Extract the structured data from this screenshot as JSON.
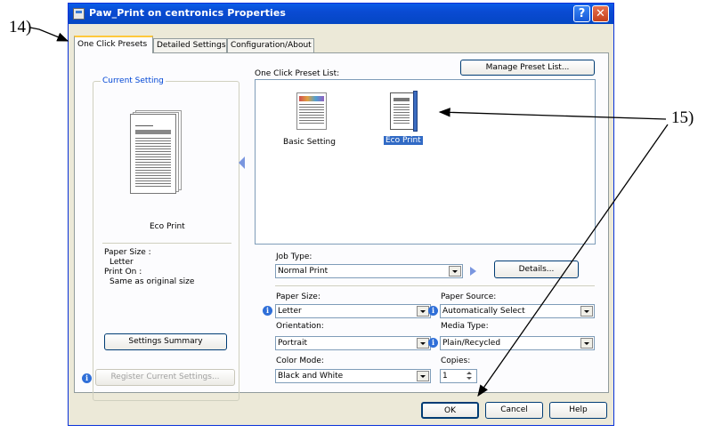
{
  "window": {
    "title": "Paw_Print on centronics Properties"
  },
  "tabs": [
    {
      "label": "One Click Presets"
    },
    {
      "label": "Detailed Settings"
    },
    {
      "label": "Configuration/About"
    }
  ],
  "current_setting": {
    "group_label": "Current Setting",
    "preset_name": "Eco Print",
    "paper_size_label": "Paper Size :",
    "paper_size_value": "Letter",
    "print_on_label": "Print On :",
    "print_on_value": "Same as original size",
    "summary_button": "Settings Summary"
  },
  "register_button": "Register Current Settings...",
  "preset_list": {
    "label": "One Click Preset List:",
    "manage_button": "Manage Preset List...",
    "items": [
      {
        "label": "Basic Setting",
        "selected": false
      },
      {
        "label": "Eco Print",
        "selected": true
      }
    ]
  },
  "job_type": {
    "label": "Job Type:",
    "value": "Normal Print",
    "details_button": "Details..."
  },
  "paper_size": {
    "label": "Paper Size:",
    "value": "Letter"
  },
  "orientation": {
    "label": "Orientation:",
    "value": "Portrait"
  },
  "color_mode": {
    "label": "Color Mode:",
    "value": "Black and White"
  },
  "paper_source": {
    "label": "Paper Source:",
    "value": "Automatically Select"
  },
  "media_type": {
    "label": "Media Type:",
    "value": "Plain/Recycled"
  },
  "copies": {
    "label": "Copies:",
    "value": "1"
  },
  "footer": {
    "ok": "OK",
    "cancel": "Cancel",
    "help": "Help"
  },
  "annotations": {
    "callout_14": "14)",
    "callout_15": "15)"
  },
  "colors": {
    "title_bar": "#0a4ad2",
    "active_tab_accent": "#ffc83c",
    "selection": "#316ac5"
  }
}
